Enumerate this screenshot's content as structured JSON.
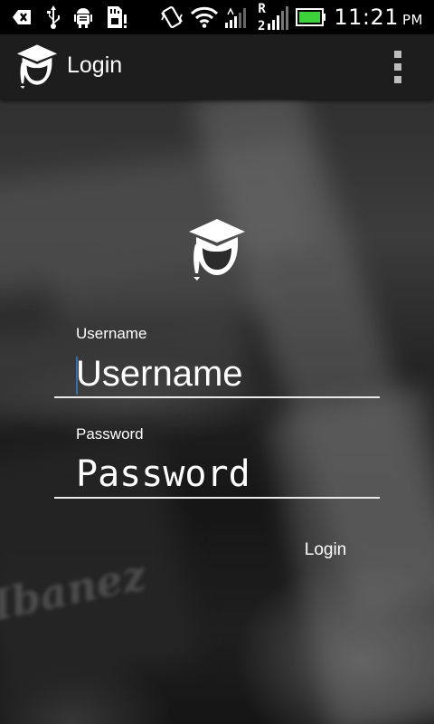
{
  "status_bar": {
    "time": "11:21",
    "ampm": "PM",
    "left_icons": [
      "back-arrow-icon",
      "usb-icon",
      "android-debug-icon",
      "sd-card-warning-icon"
    ],
    "right_icons": [
      "vibrate-icon",
      "wifi-icon",
      "signal-icon",
      "roaming-signal-icon",
      "battery-icon"
    ],
    "roaming_label": "R",
    "battery_color": "#3cd23c"
  },
  "action_bar": {
    "title": "Login",
    "logo_icon": "graduate-cap-logo-icon",
    "menu_icon": "overflow-menu-icon"
  },
  "form": {
    "logo_icon": "graduate-cap-logo-icon",
    "username_label": "Username",
    "username_placeholder": "Username",
    "password_label": "Password",
    "password_placeholder": "Password",
    "login_button": "Login"
  },
  "background": {
    "brand_text": "Ibanez"
  }
}
